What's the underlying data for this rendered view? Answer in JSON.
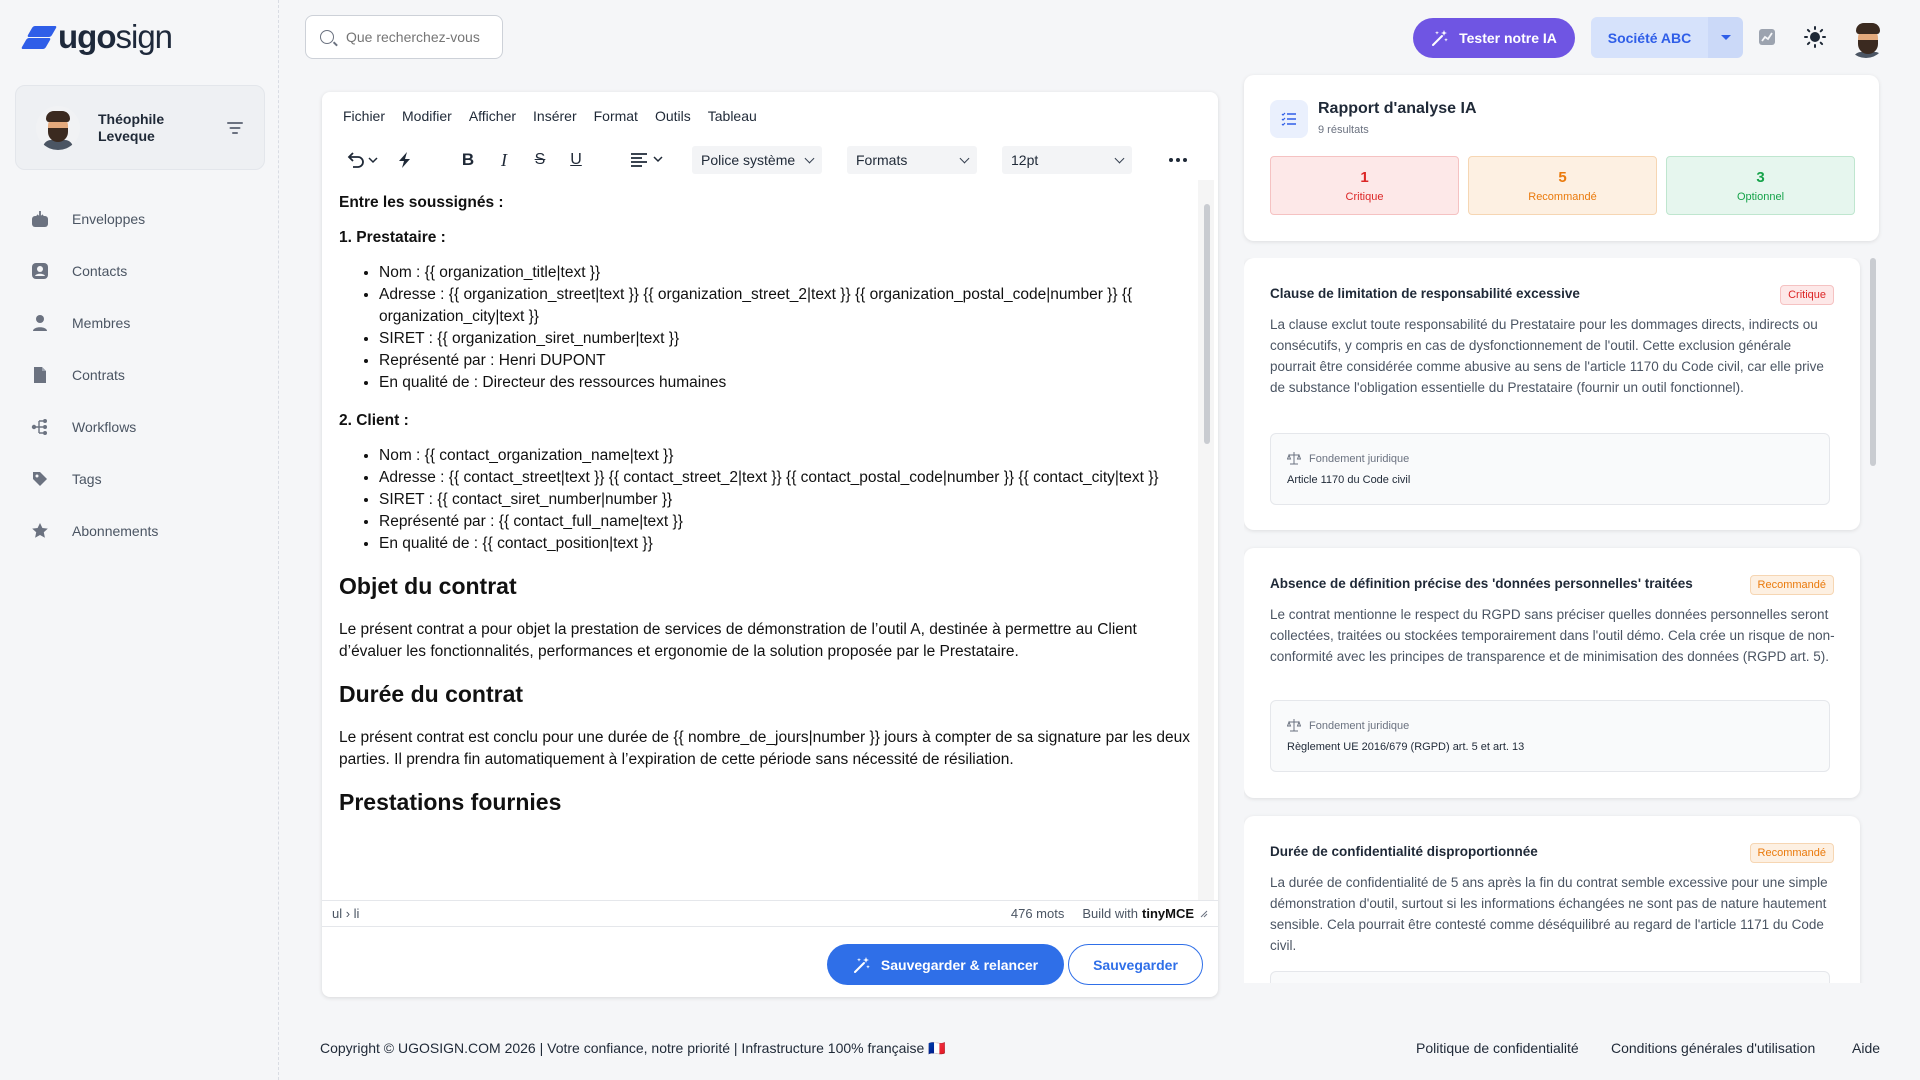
{
  "app": {
    "logo_text_bold": "ugo",
    "logo_text_light": "sign"
  },
  "user": {
    "name": "Théophile Leveque"
  },
  "nav": {
    "items": [
      {
        "label": "Enveloppes",
        "icon": "inbox-icon"
      },
      {
        "label": "Contacts",
        "icon": "contact-card-icon"
      },
      {
        "label": "Membres",
        "icon": "user-icon"
      },
      {
        "label": "Contrats",
        "icon": "document-icon"
      },
      {
        "label": "Workflows",
        "icon": "workflow-icon"
      },
      {
        "label": "Tags",
        "icon": "tag-icon"
      },
      {
        "label": "Abonnements",
        "icon": "star-badge-icon"
      }
    ]
  },
  "topbar": {
    "search_placeholder": "Que recherchez-vous",
    "ai_button": "Tester notre IA",
    "company": "Société ABC"
  },
  "editor": {
    "menu": [
      "Fichier",
      "Modifier",
      "Afficher",
      "Insérer",
      "Format",
      "Outils",
      "Tableau"
    ],
    "font_select": "Police système",
    "formats_select": "Formats",
    "size_select": "12pt",
    "content": {
      "intro": "Entre les soussignés :",
      "party1_title": "1. Prestataire :",
      "party1_items": [
        "Nom : {{ organization_title|text }}",
        "Adresse : {{ organization_street|text }} {{ organization_street_2|text }} {{ organization_postal_code|number }} {{ organization_city|text }}",
        "SIRET : {{ organization_siret_number|text }}",
        "Représenté par : Henri DUPONT",
        "En qualité de : Directeur des ressources humaines"
      ],
      "party2_title": "2. Client :",
      "party2_items": [
        "Nom : {{ contact_organization_name|text }}",
        "Adresse : {{ contact_street|text }} {{ contact_street_2|text }} {{ contact_postal_code|number }} {{ contact_city|text }}",
        "SIRET : {{ contact_siret_number|number }}",
        "Représenté par : {{ contact_full_name|text }}",
        "En qualité de : {{ contact_position|text }}"
      ],
      "h_objet": "Objet du contrat",
      "p_objet": "Le présent contrat a pour objet la prestation de services de démonstration de l’outil A, destinée à permettre au Client d’évaluer les fonctionnalités, performances et ergonomie de la solution proposée par le Prestataire.",
      "h_duree": "Durée du contrat",
      "p_duree": "Le présent contrat est conclu pour une durée de {{ nombre_de_jours|number }} jours à compter de sa signature par les deux parties. Il prendra fin automatiquement à l’expiration de cette période sans nécessité de résiliation.",
      "h_prest": "Prestations fournies"
    },
    "status_path": "ul › li",
    "word_count": "476 mots",
    "build_with": "Build with",
    "tinymce": "tinyMCE",
    "save_relaunch": "Sauvegarder & relancer",
    "save": "Sauvegarder"
  },
  "report": {
    "title": "Rapport d'analyse IA",
    "subtitle": "9 résultats",
    "stats": [
      {
        "count": "1",
        "label": "Critique",
        "color": "#dc2626",
        "bg": "#fde8e8",
        "border": "#f5c2c2"
      },
      {
        "count": "5",
        "label": "Recommandé",
        "color": "#ea7a0c",
        "bg": "#fdf0e2",
        "border": "#f6d6b3"
      },
      {
        "count": "3",
        "label": "Optionnel",
        "color": "#16a34a",
        "bg": "#e6f6ee",
        "border": "#bfe6cf"
      }
    ]
  },
  "issues": [
    {
      "title": "Clause de limitation de responsabilité excessive",
      "badge": "Critique",
      "severity": "critical",
      "description": "La clause exclut toute responsabilité du Prestataire pour les dommages directs, indirects ou consécutifs, y compris en cas de dysfonctionnement de l'outil. Cette exclusion générale pourrait être considérée comme abusive au sens de l'article 1170 du Code civil, car elle prive de substance l'obligation essentielle du Prestataire (fournir un outil fonctionnel).",
      "legal_label": "Fondement juridique",
      "legal_value": "Article 1170 du Code civil"
    },
    {
      "title": "Absence de définition précise des 'données personnelles' traitées",
      "badge": "Recommandé",
      "severity": "recommended",
      "description": "Le contrat mentionne le respect du RGPD sans préciser quelles données personnelles seront collectées, traitées ou stockées temporairement dans l'outil démo. Cela crée un risque de non-conformité avec les principes de transparence et de minimisation des données (RGPD art. 5).",
      "legal_label": "Fondement juridique",
      "legal_value": "Règlement UE 2016/679 (RGPD) art. 5 et art. 13"
    },
    {
      "title": "Durée de confidentialité disproportionnée",
      "badge": "Recommandé",
      "severity": "recommended",
      "description": "La durée de confidentialité de 5 ans après la fin du contrat semble excessive pour une simple démonstration d'outil, surtout si les informations échangées ne sont pas de nature hautement sensible. Cela pourrait être contesté comme déséquilibré au regard de l'article 1171 du Code civil.",
      "legal_label": "",
      "legal_value": ""
    }
  ],
  "footer": {
    "copyright": "Copyright © UGOSIGN.COM 2026 | Votre confiance, notre priorité | Infrastructure 100% française 🇫🇷",
    "privacy": "Politique de confidentialité",
    "terms": "Conditions générales d'utilisation",
    "help": "Aide"
  }
}
